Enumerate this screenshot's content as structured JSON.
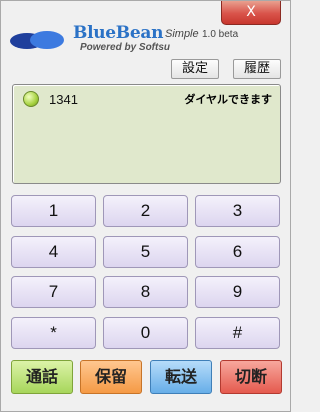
{
  "window": {
    "close_label": "X"
  },
  "header": {
    "brand": "BlueBean",
    "edition": "Simple",
    "version": "1.0 beta",
    "powered_by": "Powered by Softsu"
  },
  "toolbar": {
    "settings_label": "設定",
    "history_label": "履歴"
  },
  "display": {
    "number": "1341",
    "status": "ダイヤルできます",
    "lamp_color": "#a7d241"
  },
  "keypad": {
    "keys": [
      "1",
      "2",
      "3",
      "4",
      "5",
      "6",
      "7",
      "8",
      "9",
      "*",
      "0",
      "#"
    ]
  },
  "actions": {
    "call": "通話",
    "hold": "保留",
    "transfer": "転送",
    "hangup": "切断"
  },
  "colors": {
    "call": "#a7d65b",
    "hold": "#f59a45",
    "transfer": "#67aee8",
    "hangup": "#e55a4e",
    "close": "#d9534a",
    "display_bg": "#e0e8cc",
    "key_bg": "#dcd5ef",
    "brand": "#2b72c6"
  }
}
